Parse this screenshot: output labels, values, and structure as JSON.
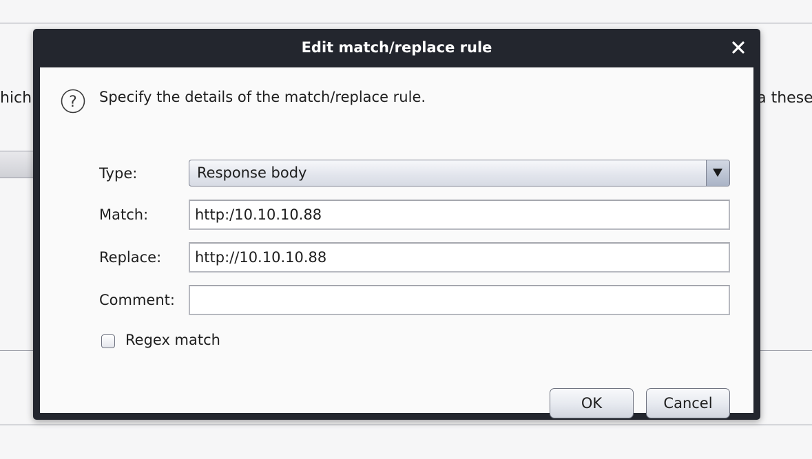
{
  "background": {
    "left_text": "hich",
    "right_text": "ia these"
  },
  "dialog": {
    "title": "Edit match/replace rule",
    "close_icon": "close-icon",
    "message_icon": "question-icon",
    "message": "Specify the details of the match/replace rule.",
    "type_label": "Type:",
    "type_value": "Response body",
    "match_label": "Match:",
    "match_value": "http:/10.10.10.88",
    "replace_label": "Replace:",
    "replace_value": "http://10.10.10.88",
    "comment_label": "Comment:",
    "comment_value": "",
    "regex_label": "Regex match",
    "regex_checked": false,
    "ok_label": "OK",
    "cancel_label": "Cancel"
  }
}
